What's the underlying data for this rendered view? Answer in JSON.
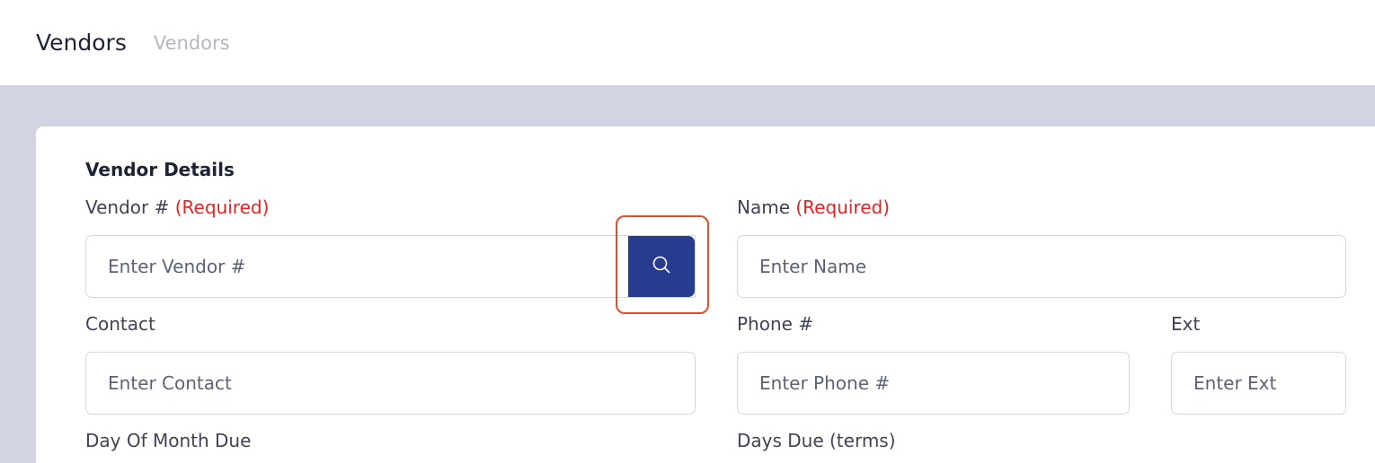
{
  "header": {
    "title": "Vendors",
    "breadcrumb": "Vendors"
  },
  "form": {
    "section_title": "Vendor Details",
    "vendor_number": {
      "label": "Vendor #",
      "required": "(Required)",
      "placeholder": "Enter Vendor #"
    },
    "name": {
      "label": "Name",
      "required": "(Required)",
      "placeholder": "Enter Name"
    },
    "contact": {
      "label": "Contact",
      "placeholder": "Enter Contact"
    },
    "phone": {
      "label": "Phone #",
      "placeholder": "Enter Phone #"
    },
    "ext": {
      "label": "Ext",
      "placeholder": "Enter Ext"
    },
    "day_of_month_due": {
      "label": "Day Of Month Due"
    },
    "days_due": {
      "label": "Days Due (terms)"
    }
  },
  "colors": {
    "accent": "#273b8f",
    "required": "#f01e1e",
    "highlight": "#d9512e",
    "background": "#d3d4e1"
  },
  "icons": {
    "search": "search-icon"
  }
}
